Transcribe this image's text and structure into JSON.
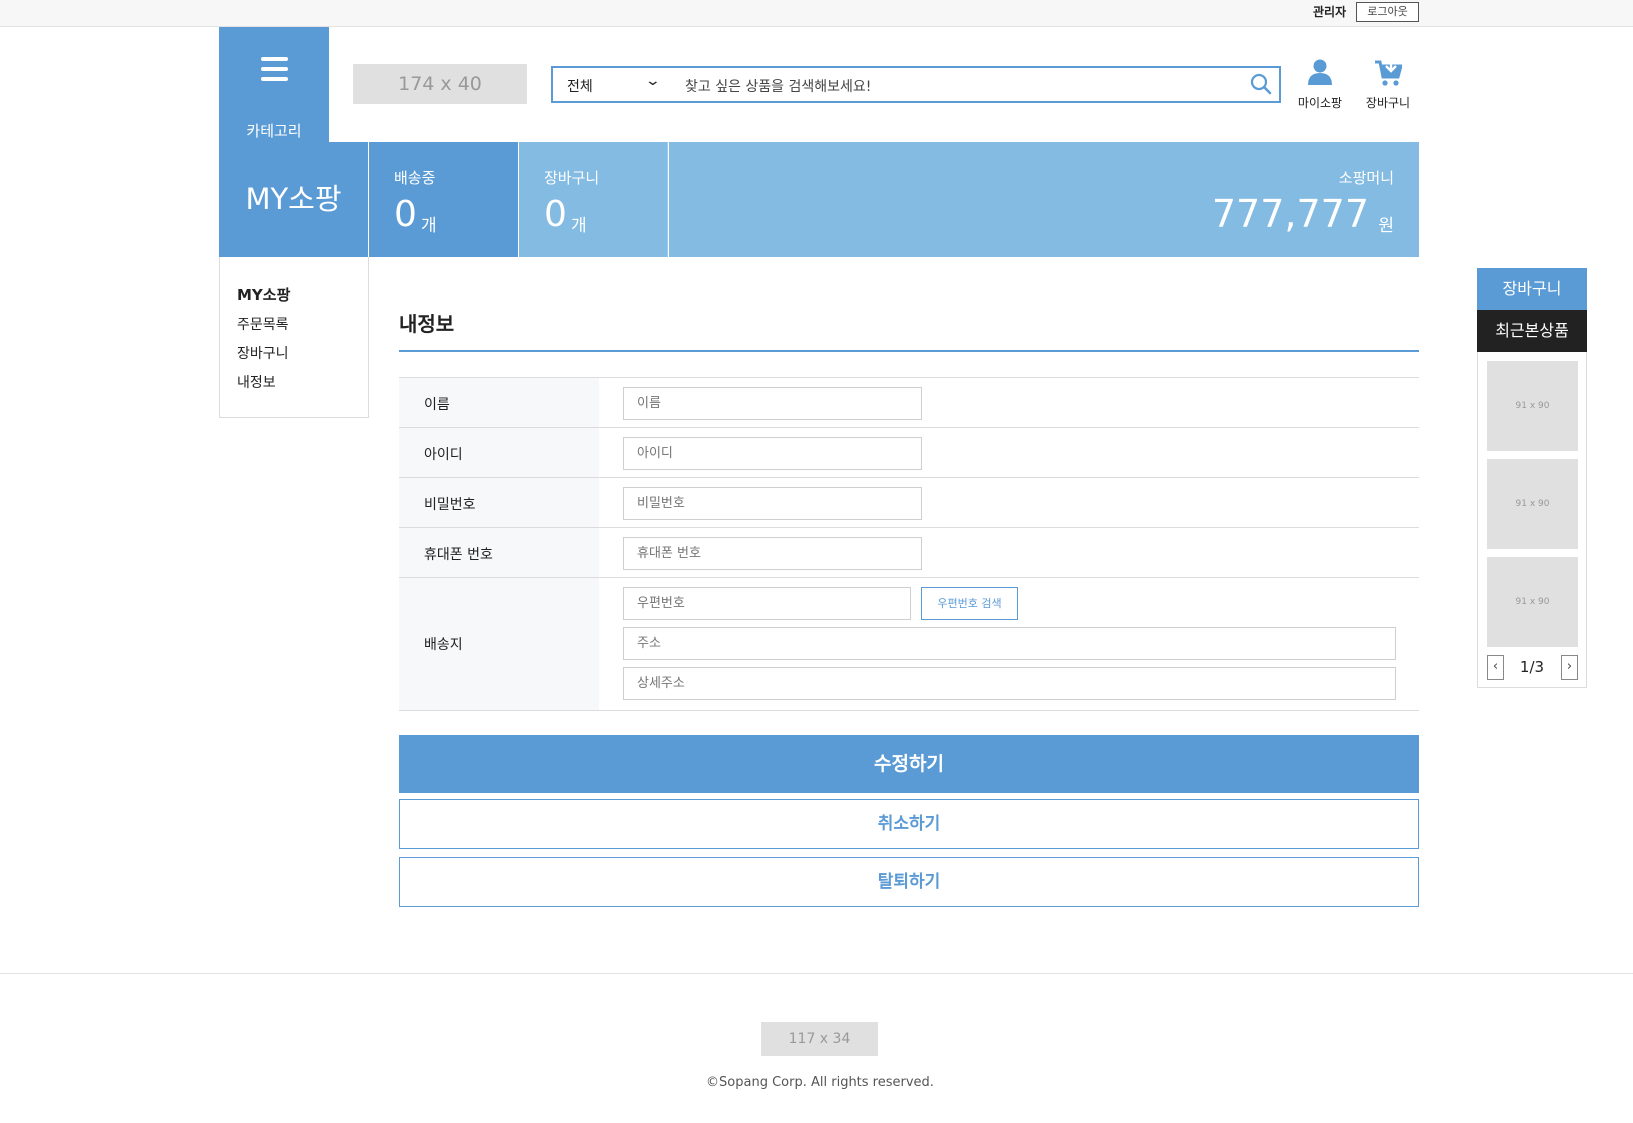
{
  "topbar": {
    "admin": "관리자",
    "logout": "로그아웃"
  },
  "header": {
    "category": "카테고리",
    "logo_placeholder": "174 x 40",
    "search_select": "전체",
    "search_placeholder": "찾고 싶은 상품을 검색해보세요!",
    "mypage": "마이소팡",
    "cart": "장바구니"
  },
  "stats": {
    "title": "MY소팡",
    "shipping_label": "배송중",
    "shipping_count": "0",
    "shipping_unit": "개",
    "cart_label": "장바구니",
    "cart_count": "0",
    "cart_unit": "개",
    "money_label": "소팡머니",
    "money_value": "777,777",
    "money_unit": "원"
  },
  "menu": {
    "items": [
      "MY소팡",
      "주문목록",
      "장바구니",
      "내정보"
    ]
  },
  "form": {
    "title": "내정보",
    "name_label": "이름",
    "name_placeholder": "이름",
    "id_label": "아이디",
    "id_placeholder": "아이디",
    "pw_label": "비밀번호",
    "pw_placeholder": "비밀번호",
    "phone_label": "휴대폰 번호",
    "phone_placeholder": "휴대폰 번호",
    "addr_label": "배송지",
    "zip_placeholder": "우편번호",
    "zip_button": "우편번호 검색",
    "addr_placeholder": "주소",
    "addr_detail_placeholder": "상세주소"
  },
  "buttons": {
    "submit": "수정하기",
    "cancel": "취소하기",
    "withdraw": "탈퇴하기"
  },
  "side": {
    "cart": "장바구니",
    "recent": "최근본상품",
    "thumbs": [
      "91 x 90",
      "91 x 90",
      "91 x 90"
    ],
    "page": "1/3",
    "prev": "‹",
    "next": "›"
  },
  "footer": {
    "logo_placeholder": "117 x 34",
    "copyright": "©Sopang Corp. All rights reserved."
  },
  "colors": {
    "accent": "#5b9bd5",
    "accent_light": "#84bbe3",
    "dark": "#222222"
  },
  "icons": [
    "menu-icon",
    "chevron-down-icon",
    "search-icon",
    "user-icon",
    "cart-icon",
    "chevron-left-icon",
    "chevron-right-icon"
  ]
}
